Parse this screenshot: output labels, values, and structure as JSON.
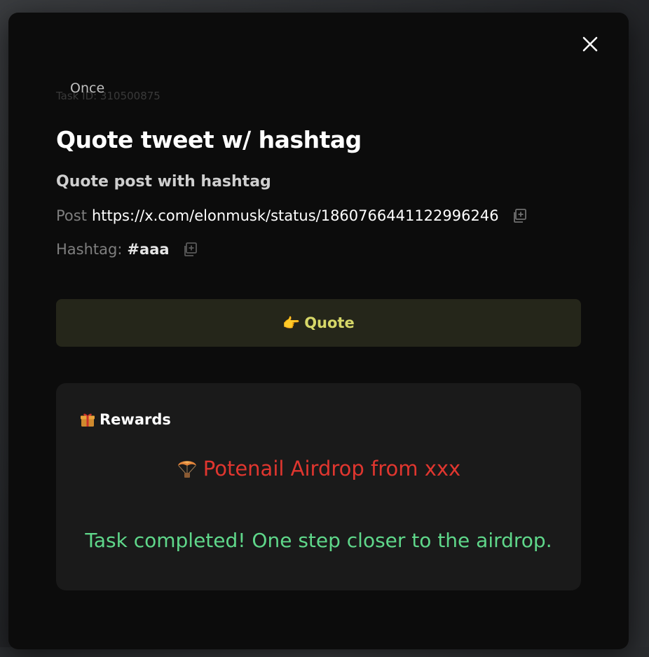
{
  "modal": {
    "close_icon": "close-icon",
    "task_id": "Task ID: 310500875",
    "frequency": "Once",
    "title": "Quote tweet w/ hashtag",
    "subtitle": "Quote post with hashtag",
    "post_label": "Post",
    "post_url": "https://x.com/elonmusk/status/1860766441122996246",
    "hashtag_label": "Hashtag:",
    "hashtag_value": "#aaa",
    "copy_icon": "copy-icon",
    "quote_button": {
      "emoji": "👉",
      "label": "Quote"
    },
    "rewards": {
      "icon": "gift-icon",
      "title": "Rewards",
      "airdrop_icon": "parachute-icon",
      "airdrop_text": "Potenail Airdrop from xxx",
      "completed_text": "Task completed! One step closer to the airdrop."
    }
  },
  "colors": {
    "modal_bg": "#0c0c0c",
    "quote_button_bg": "#25261a",
    "quote_label": "#d6d768",
    "rewards_card_bg": "#1a1a1a",
    "airdrop_text": "#e0362f",
    "completed_text": "#5fd78a"
  }
}
